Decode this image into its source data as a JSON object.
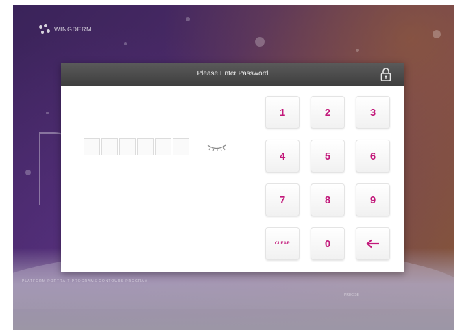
{
  "brand": {
    "logo_text": "WINGDERM"
  },
  "dialog": {
    "title": "Please Enter Password",
    "lock_icon": "lock-icon",
    "eye_icon": "eye-closed-icon",
    "password_length": 6
  },
  "keypad": {
    "keys": [
      "1",
      "2",
      "3",
      "4",
      "5",
      "6",
      "7",
      "8",
      "9",
      "CLEAR",
      "0",
      "←"
    ]
  },
  "background": {
    "bottom_text": "PLATFORM PORTRAIT PROGRAMS CONTOURS PROGRAM",
    "bottom_right_text": "PRECISE"
  },
  "colors": {
    "accent": "#c2187a",
    "header": "#4a4a4a"
  }
}
